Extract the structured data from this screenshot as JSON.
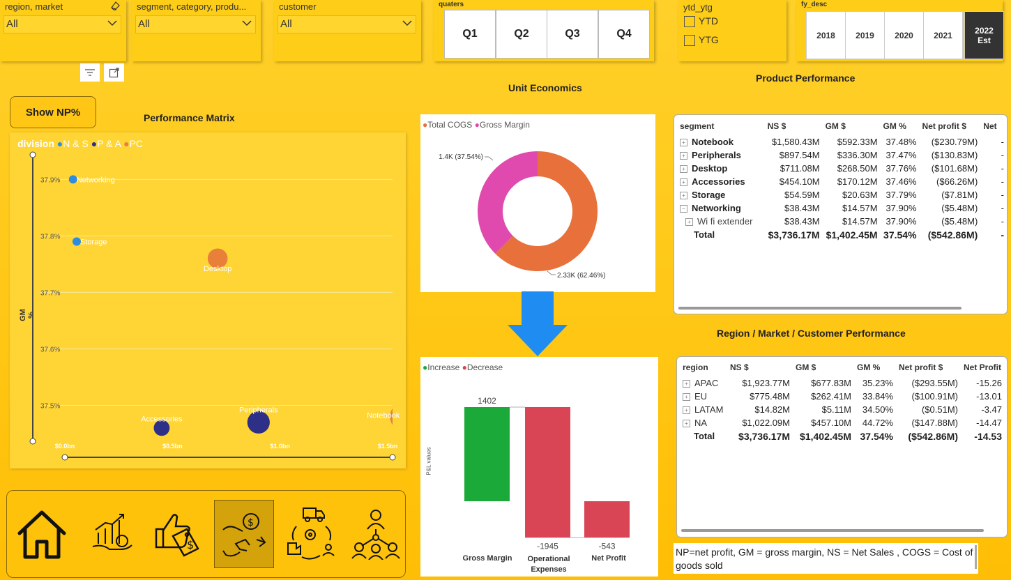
{
  "slicers": {
    "region": {
      "label": "region, market",
      "value": "All"
    },
    "segment": {
      "label": "segment, category, produ...",
      "value": "All"
    },
    "customer": {
      "label": "customer",
      "value": "All"
    },
    "quarters": {
      "label": "quaters",
      "items": [
        "Q1",
        "Q2",
        "Q3",
        "Q4"
      ]
    },
    "ytd_ytg": {
      "label": "ytd_ytg",
      "items": [
        "YTD",
        "YTG"
      ]
    },
    "fy_desc": {
      "label": "fy_desc",
      "items": [
        "2018",
        "2019",
        "2020",
        "2021"
      ],
      "selected_line1": "2022",
      "selected_line2": "Est"
    }
  },
  "show_np_button": "Show NP%",
  "performance_matrix": {
    "title": "Performance Matrix",
    "legend_title": "division",
    "legend": [
      {
        "name": "N & S",
        "color": "#2B8CE0"
      },
      {
        "name": "P & A",
        "color": "#2E2F86"
      },
      {
        "name": "PC",
        "color": "#E8803A"
      }
    ],
    "y_axis_title": "GM %",
    "y_ticks": [
      "37.9%",
      "37.8%",
      "37.7%",
      "37.6%",
      "37.5%"
    ],
    "x_ticks": [
      "$0.0bn",
      "$0.5bn",
      "$1.0bn",
      "$1.5bn"
    ]
  },
  "chart_data": [
    {
      "type": "scatter",
      "title": "Performance Matrix",
      "ylabel": "GM %",
      "xlim": [
        0,
        1.5
      ],
      "ylim": [
        37.45,
        37.93
      ],
      "points": [
        {
          "label": "Networking",
          "x": 0.038,
          "y": 37.9,
          "division": "N & S"
        },
        {
          "label": "Storage",
          "x": 0.055,
          "y": 37.79,
          "division": "N & S"
        },
        {
          "label": "Desktop",
          "x": 0.71,
          "y": 37.76,
          "division": "PC"
        },
        {
          "label": "Accessories",
          "x": 0.45,
          "y": 37.46,
          "division": "P & A"
        },
        {
          "label": "Peripherals",
          "x": 0.9,
          "y": 37.47,
          "division": "P & A"
        },
        {
          "label": "Notebook",
          "x": 1.58,
          "y": 37.48,
          "division": "PC"
        }
      ]
    },
    {
      "type": "pie",
      "title": "Unit Economics",
      "legend": [
        "Total COGS",
        "Gross Margin"
      ],
      "slices": [
        {
          "name": "Total COGS",
          "value": 2334,
          "label": "2.33K (62.46%)",
          "color": "#E8703A"
        },
        {
          "name": "Gross Margin",
          "value": 1402,
          "label": "1.4K (37.54%)",
          "color": "#E04AAE"
        }
      ]
    },
    {
      "type": "bar",
      "subtype": "waterfall",
      "legend": [
        "Increase",
        "Decrease"
      ],
      "ylabel": "P&L values",
      "categories": [
        "Gross Margin",
        "Operational Expenses",
        "Net Profit"
      ],
      "values": [
        1402,
        -1945,
        -543
      ],
      "value_labels": [
        "1402",
        "-1945",
        "-543"
      ]
    }
  ],
  "unit_economics": {
    "title": "Unit Economics",
    "legend": [
      {
        "name": "Total COGS",
        "color": "#E8703A"
      },
      {
        "name": "Gross Margin",
        "color": "#E04AAE"
      }
    ],
    "labels": {
      "cogs": "2.33K (62.46%)",
      "gm": "1.4K (37.54%)"
    }
  },
  "waterfall": {
    "legend": [
      {
        "name": "Increase",
        "color": "#1BAA3A"
      },
      {
        "name": "Decrease",
        "color": "#D94554"
      }
    ],
    "y_axis_title": "P&L values",
    "categories": [
      "Gross Margin",
      "Operational",
      "Net Profit"
    ],
    "category2": "Expenses",
    "value_labels": [
      "1402",
      "-1945",
      "-543"
    ]
  },
  "product_performance": {
    "title": "Product Performance",
    "headers": [
      "segment",
      "NS $",
      "GM $",
      "GM %",
      "Net profit $",
      "Net"
    ],
    "rows": [
      {
        "name": "Notebook",
        "ns": "$1,580.43M",
        "gm": "$592.33M",
        "gmp": "37.48%",
        "np": "($230.79M)",
        "npp": "-",
        "icon": "+"
      },
      {
        "name": "Peripherals",
        "ns": "$897.54M",
        "gm": "$336.30M",
        "gmp": "37.47%",
        "np": "($130.83M)",
        "npp": "-",
        "icon": "+"
      },
      {
        "name": "Desktop",
        "ns": "$711.08M",
        "gm": "$268.50M",
        "gmp": "37.76%",
        "np": "($101.68M)",
        "npp": "-",
        "icon": "+"
      },
      {
        "name": "Accessories",
        "ns": "$454.10M",
        "gm": "$170.12M",
        "gmp": "37.46%",
        "np": "($66.26M)",
        "npp": "-",
        "icon": "+"
      },
      {
        "name": "Storage",
        "ns": "$54.59M",
        "gm": "$20.63M",
        "gmp": "37.79%",
        "np": "($7.81M)",
        "npp": "-",
        "icon": "+"
      },
      {
        "name": "Networking",
        "ns": "$38.43M",
        "gm": "$14.57M",
        "gmp": "37.90%",
        "np": "($5.48M)",
        "npp": "-",
        "icon": "−"
      },
      {
        "name": "Wi fi extender",
        "ns": "$38.43M",
        "gm": "$14.57M",
        "gmp": "37.90%",
        "np": "($5.48M)",
        "npp": "-",
        "icon": "+"
      }
    ],
    "total": {
      "name": "Total",
      "ns": "$3,736.17M",
      "gm": "$1,402.45M",
      "gmp": "37.54%",
      "np": "($542.86M)",
      "npp": "-"
    }
  },
  "region_performance": {
    "title": "Region / Market / Customer Performance",
    "headers": [
      "region",
      "NS $",
      "GM $",
      "GM %",
      "Net profit $",
      "Net Profit"
    ],
    "rows": [
      {
        "name": "APAC",
        "ns": "$1,923.77M",
        "gm": "$677.83M",
        "gmp": "35.23%",
        "np": "($293.55M)",
        "npp": "-15.26"
      },
      {
        "name": "EU",
        "ns": "$775.48M",
        "gm": "$262.41M",
        "gmp": "33.84%",
        "np": "($100.91M)",
        "npp": "-13.01"
      },
      {
        "name": "LATAM",
        "ns": "$14.82M",
        "gm": "$5.11M",
        "gmp": "34.50%",
        "np": "($0.51M)",
        "npp": "-3.47"
      },
      {
        "name": "NA",
        "ns": "$1,022.09M",
        "gm": "$457.10M",
        "gmp": "44.72%",
        "np": "($147.88M)",
        "npp": "-14.47"
      }
    ],
    "total": {
      "name": "Total",
      "ns": "$3,736.17M",
      "gm": "$1,402.45M",
      "gmp": "37.54%",
      "np": "($542.86M)",
      "npp": "-14.53"
    }
  },
  "note": "NP=net profit, GM = gross margin, NS = Net Sales , COGS = Cost of goods sold",
  "nav": [
    "home-icon",
    "growth-chart-icon",
    "like-price-tag-icon",
    "money-exchange-icon",
    "supply-chain-icon",
    "team-network-icon"
  ]
}
